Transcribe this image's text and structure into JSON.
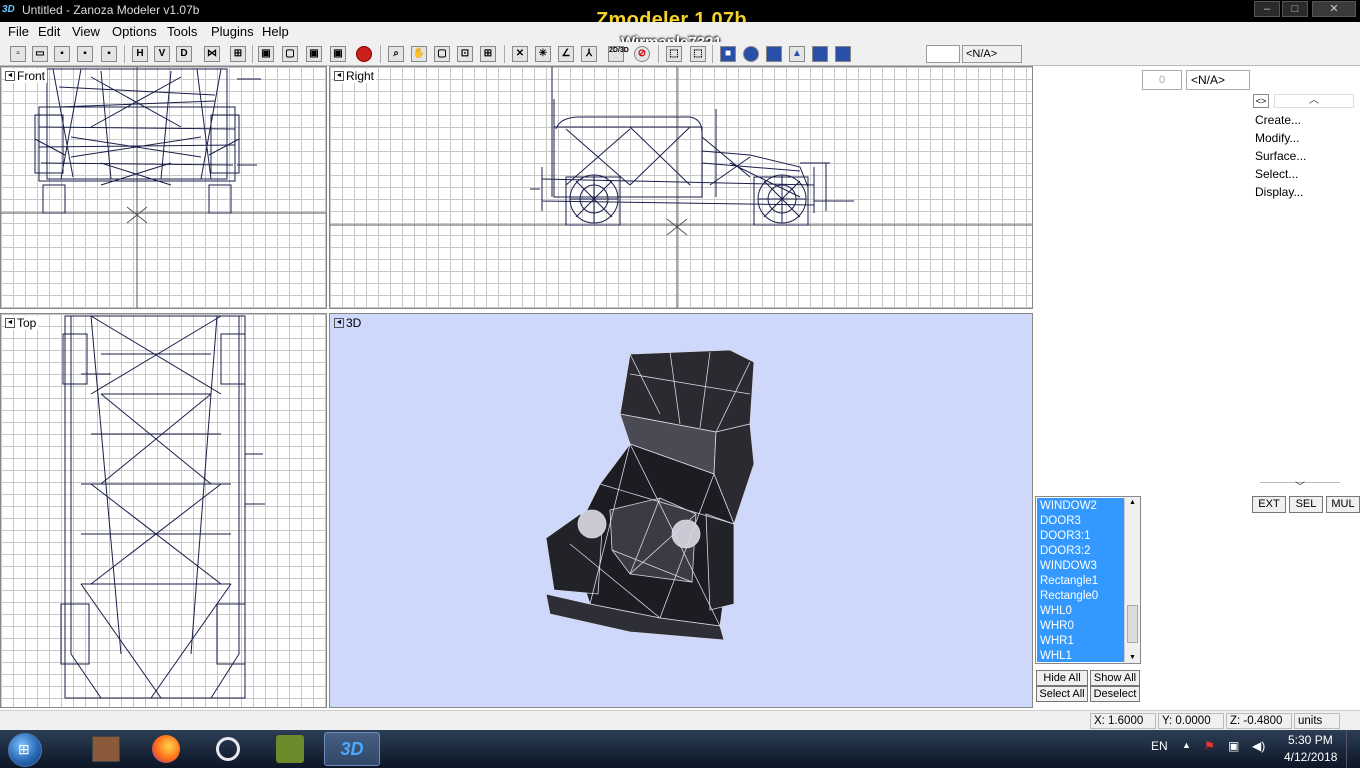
{
  "window": {
    "title": "Untitled - Zanoza Modeler v1.07b",
    "app_icon": "3D",
    "overlay_title": "Zmodeler 1.07b",
    "overlay_subtitle": "Wirmaple7321",
    "minimize": "–",
    "maximize": "□",
    "close": "✕"
  },
  "menu": [
    "File",
    "Edit",
    "View",
    "Options",
    "Tools",
    "Plugins",
    "Help"
  ],
  "toolbar": {
    "mode_letters": [
      "H",
      "V",
      "D"
    ],
    "view_label": "2D/3D",
    "selection_value": "<N/A>"
  },
  "viewports": {
    "front": "Front",
    "right": "Right",
    "top": "Top",
    "perspective": "3D"
  },
  "panel": {
    "spinner_value": "0",
    "selection_value": "<N/A>",
    "tool_toggle": "<>",
    "commands": [
      "Create...",
      "Modify...",
      "Surface...",
      "Select...",
      "Display..."
    ],
    "mode_buttons": [
      "EXT",
      "SEL",
      "MUL"
    ]
  },
  "object_list": {
    "items": [
      "WINDOW2",
      "DOOR3",
      "DOOR3:1",
      "DOOR3:2",
      "WINDOW3",
      "Rectangle1",
      "Rectangle0",
      "WHL0",
      "WHR0",
      "WHR1",
      "WHL1"
    ],
    "hide_all": "Hide All",
    "show_all": "Show All",
    "select_all": "Select All",
    "deselect": "Deselect"
  },
  "status": {
    "x": "X: 1.6000",
    "y": "Y: 0.0000",
    "z": "Z: -0.4800",
    "units": "units"
  },
  "taskbar": {
    "language": "EN",
    "time": "5:30 PM",
    "date": "4/12/2018",
    "active_app_label": "3D"
  },
  "colors": {
    "wireframe": "#1a1f4a",
    "viewport_3d_bg": "#cdd8fb",
    "selection_blue": "#3399ff",
    "overlay_title": "#f7d32a"
  }
}
